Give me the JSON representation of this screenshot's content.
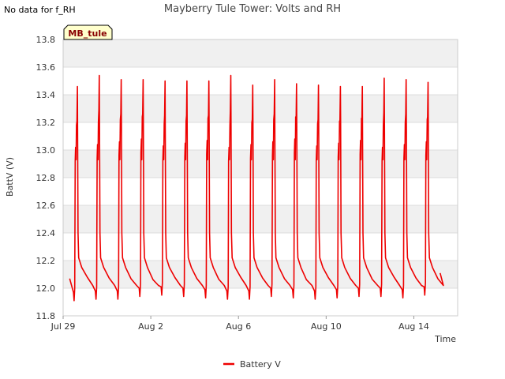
{
  "notice": "No data for f_RH",
  "chart_data": {
    "type": "line",
    "title": "Mayberry Tule Tower: Volts and RH",
    "xlabel": "Time",
    "ylabel": "BattV (V)",
    "station_label": "MB_tule",
    "ylim": [
      11.8,
      13.8
    ],
    "yticks": [
      11.8,
      12.0,
      12.2,
      12.4,
      12.6,
      12.8,
      13.0,
      13.2,
      13.4,
      13.6,
      13.8
    ],
    "xlim_days": [
      0,
      18
    ],
    "xticks": [
      {
        "label": "Jul 29",
        "day": 0
      },
      {
        "label": "Aug 2",
        "day": 4
      },
      {
        "label": "Aug 6",
        "day": 8
      },
      {
        "label": "Aug 10",
        "day": 12
      },
      {
        "label": "Aug 14",
        "day": 16
      }
    ],
    "grid": true,
    "legend_position": "bottom-center",
    "series": [
      {
        "name": "Battery V",
        "color": "#ee0000",
        "start_day": 0.3,
        "start_v": 12.07,
        "end_day": 17.2,
        "end_v": 12.11,
        "cycles": [
          {
            "min_day": 0.5,
            "min_v": 11.91,
            "peak_day": 0.65,
            "peak_v": 13.46
          },
          {
            "min_day": 1.5,
            "min_v": 11.92,
            "peak_day": 1.65,
            "peak_v": 13.54
          },
          {
            "min_day": 2.5,
            "min_v": 11.92,
            "peak_day": 2.65,
            "peak_v": 13.51
          },
          {
            "min_day": 3.5,
            "min_v": 11.94,
            "peak_day": 3.65,
            "peak_v": 13.51
          },
          {
            "min_day": 4.5,
            "min_v": 11.95,
            "peak_day": 4.65,
            "peak_v": 13.5
          },
          {
            "min_day": 5.5,
            "min_v": 11.94,
            "peak_day": 5.65,
            "peak_v": 13.5
          },
          {
            "min_day": 6.5,
            "min_v": 11.93,
            "peak_day": 6.65,
            "peak_v": 13.5
          },
          {
            "min_day": 7.5,
            "min_v": 11.92,
            "peak_day": 7.65,
            "peak_v": 13.54
          },
          {
            "min_day": 8.5,
            "min_v": 11.92,
            "peak_day": 8.65,
            "peak_v": 13.47
          },
          {
            "min_day": 9.5,
            "min_v": 11.94,
            "peak_day": 9.65,
            "peak_v": 13.51
          },
          {
            "min_day": 10.5,
            "min_v": 11.93,
            "peak_day": 10.65,
            "peak_v": 13.48
          },
          {
            "min_day": 11.5,
            "min_v": 11.92,
            "peak_day": 11.65,
            "peak_v": 13.47
          },
          {
            "min_day": 12.5,
            "min_v": 11.93,
            "peak_day": 12.65,
            "peak_v": 13.46
          },
          {
            "min_day": 13.5,
            "min_v": 11.94,
            "peak_day": 13.65,
            "peak_v": 13.46
          },
          {
            "min_day": 14.5,
            "min_v": 11.94,
            "peak_day": 14.65,
            "peak_v": 13.52
          },
          {
            "min_day": 15.5,
            "min_v": 11.93,
            "peak_day": 15.65,
            "peak_v": 13.51
          },
          {
            "min_day": 16.5,
            "min_v": 11.95,
            "peak_day": 16.65,
            "peak_v": 13.49
          }
        ]
      }
    ]
  }
}
